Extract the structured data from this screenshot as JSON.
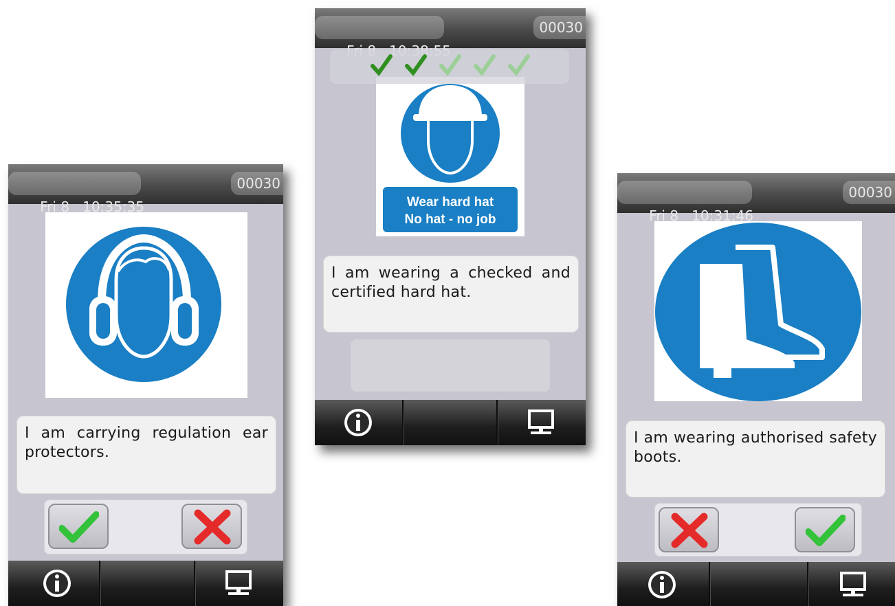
{
  "screens": {
    "left": {
      "status": {
        "date": "Fri 8",
        "time": "10:35:35",
        "counter": "00030"
      },
      "sign": "ear-protection-sign",
      "message": "I am carrying regulation ear protectors.",
      "buttons": {
        "first": "confirm",
        "second": "reject"
      },
      "toolbar": {
        "info": "info-icon",
        "terminal": "computer-icon"
      }
    },
    "middle": {
      "status": {
        "date": "Fri 8",
        "time": "10:38:55",
        "counter": "00030"
      },
      "progress": {
        "completed": 2,
        "total": 5
      },
      "sign": "hard-hat-sign",
      "sign_text_line1": "Wear hard hat",
      "sign_text_line2": "No hat - no job",
      "message": "I am wearing a checked and certified hard hat.",
      "toolbar": {
        "info": "info-icon",
        "terminal": "computer-icon"
      }
    },
    "right": {
      "status": {
        "date": "Fri 8",
        "time": "10:31:46",
        "counter": "00030"
      },
      "sign": "safety-boots-sign",
      "message": "I am wearing authorised safety boots.",
      "buttons": {
        "first": "reject",
        "second": "confirm"
      },
      "toolbar": {
        "info": "info-icon",
        "terminal": "computer-icon"
      }
    }
  },
  "colors": {
    "sign_blue": "#1a7fc4",
    "confirm_green": "#33c23a",
    "reject_red": "#e52a2a"
  }
}
